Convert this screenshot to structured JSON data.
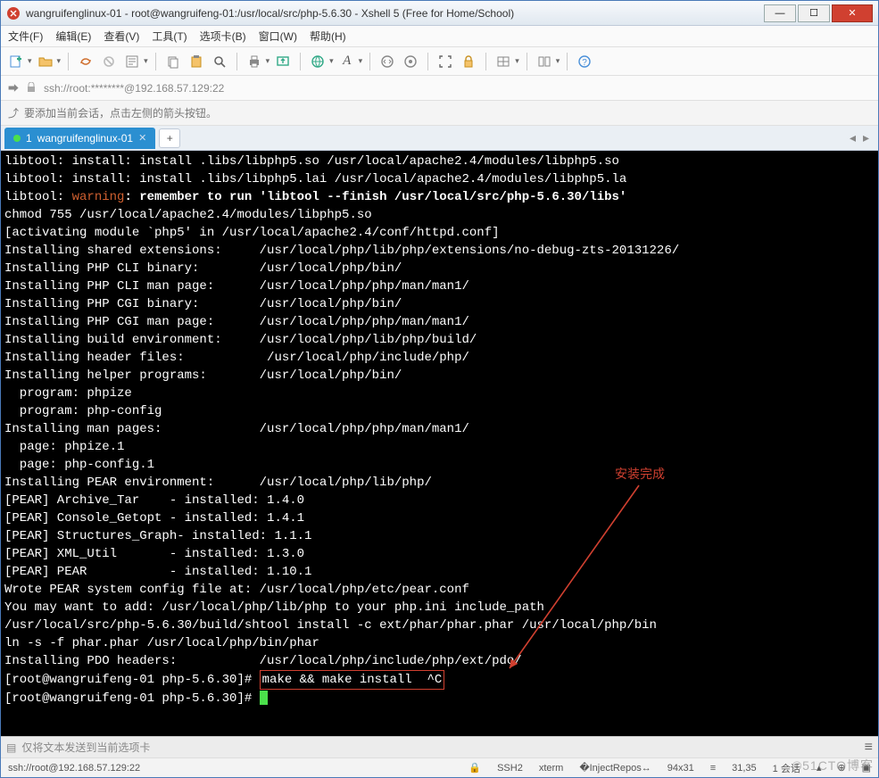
{
  "window": {
    "title": "wangruifenglinux-01 - root@wangruifeng-01:/usr/local/src/php-5.6.30 - Xshell 5 (Free for Home/School)"
  },
  "menu": {
    "file": "文件(F)",
    "edit": "编辑(E)",
    "view": "查看(V)",
    "tools": "工具(T)",
    "tabs": "选项卡(B)",
    "window": "窗口(W)",
    "help": "帮助(H)"
  },
  "address": {
    "text": "ssh://root:********@192.168.57.129:22"
  },
  "hint": {
    "text": "要添加当前会话，点击左侧的箭头按钮。"
  },
  "tab": {
    "index": "1",
    "name": "wangruifenglinux-01"
  },
  "terminal": {
    "lines": [
      "libtool: install: install .libs/libphp5.so /usr/local/apache2.4/modules/libphp5.so",
      "libtool: install: install .libs/libphp5.lai /usr/local/apache2.4/modules/libphp5.la",
      "chmod 755 /usr/local/apache2.4/modules/libphp5.so",
      "[activating module `php5' in /usr/local/apache2.4/conf/httpd.conf]",
      "Installing shared extensions:     /usr/local/php/lib/php/extensions/no-debug-zts-20131226/",
      "Installing PHP CLI binary:        /usr/local/php/bin/",
      "Installing PHP CLI man page:      /usr/local/php/php/man/man1/",
      "Installing PHP CGI binary:        /usr/local/php/bin/",
      "Installing PHP CGI man page:      /usr/local/php/php/man/man1/",
      "Installing build environment:     /usr/local/php/lib/php/build/",
      "Installing header files:           /usr/local/php/include/php/",
      "Installing helper programs:       /usr/local/php/bin/",
      "  program: phpize",
      "  program: php-config",
      "Installing man pages:             /usr/local/php/php/man/man1/",
      "  page: phpize.1",
      "  page: php-config.1",
      "Installing PEAR environment:      /usr/local/php/lib/php/",
      "[PEAR] Archive_Tar    - installed: 1.4.0",
      "[PEAR] Console_Getopt - installed: 1.4.1",
      "[PEAR] Structures_Graph- installed: 1.1.1",
      "[PEAR] XML_Util       - installed: 1.3.0",
      "[PEAR] PEAR           - installed: 1.10.1",
      "Wrote PEAR system config file at: /usr/local/php/etc/pear.conf",
      "You may want to add: /usr/local/php/lib/php to your php.ini include_path",
      "/usr/local/src/php-5.6.30/build/shtool install -c ext/phar/phar.phar /usr/local/php/bin",
      "ln -s -f phar.phar /usr/local/php/bin/phar",
      "Installing PDO headers:           /usr/local/php/include/php/ext/pdo/"
    ],
    "warning_prefix": "libtool: ",
    "warning_word": "warning",
    "warning_rest": ": remember to run 'libtool --finish /usr/local/src/php-5.6.30/libs'",
    "prompt": "[root@wangruifeng-01 php-5.6.30]# ",
    "boxed_cmd": "make && make install  ^C",
    "annotation": "安装完成"
  },
  "sendbar": {
    "text": "仅将文本发送到当前选项卡"
  },
  "status": {
    "conn": "ssh://root@192.168.57.129:22",
    "ssh": "SSH2",
    "term": "xterm",
    "size": "94x31",
    "pos": "31,35",
    "sess": "1 会话"
  },
  "watermark": "©51CTO博客"
}
